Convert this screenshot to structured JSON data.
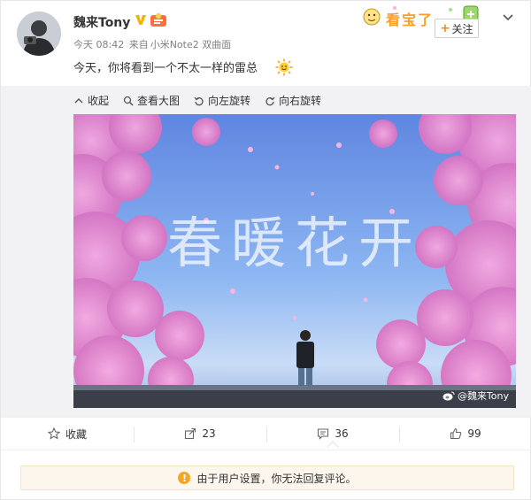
{
  "post": {
    "username": "魏来Tony",
    "time": "今天 08:42",
    "source_prefix": "来自",
    "source": "小米Note2 双曲面",
    "text": "今天，你将看到一个不太一样的雷总",
    "emoji": "sun-emoji",
    "follow_label": "关注",
    "follow_plus": "+",
    "sticker_text": "看宝了"
  },
  "media": {
    "toolbar": [
      {
        "icon": "collapse-icon",
        "label": "收起"
      },
      {
        "icon": "zoom-icon",
        "label": "查看大图"
      },
      {
        "icon": "rotate-left-icon",
        "label": "向左旋转"
      },
      {
        "icon": "rotate-right-icon",
        "label": "向右旋转"
      }
    ],
    "headline": "春暖花开",
    "watermark": "@魏来Tony"
  },
  "actions": [
    {
      "icon": "star-icon",
      "label": "收藏"
    },
    {
      "icon": "forward-icon",
      "label": "23"
    },
    {
      "icon": "comment-icon",
      "label": "36"
    },
    {
      "icon": "like-icon",
      "label": "99"
    }
  ],
  "notice": {
    "icon": "warning-icon",
    "text": "由于用户设置，你无法回复评论。"
  },
  "colors": {
    "accent": "#ff8200",
    "warning": "#f5a623",
    "sky": "#6fa2ec",
    "blossom": "#e27fc8"
  }
}
